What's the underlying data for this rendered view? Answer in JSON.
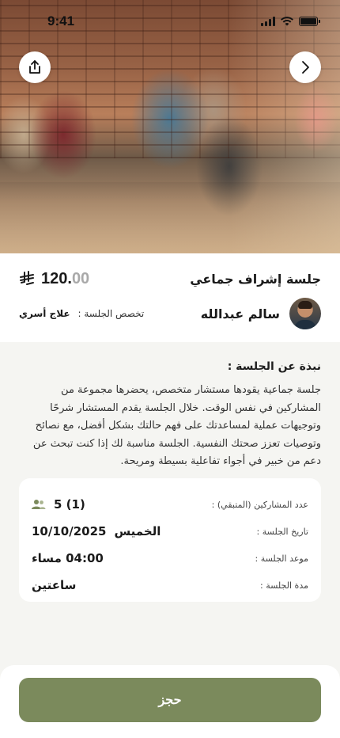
{
  "status_bar": {
    "time": "9:41"
  },
  "hero": {
    "image": "group-therapy-session-photo"
  },
  "session": {
    "title": "جلسة إشراف جماعي",
    "price_whole": "120.",
    "price_decimal": "00",
    "currency_icon": "riyal-icon",
    "counselor_name": "سالم عبدالله",
    "specialty_label": "تخصص الجلسة :",
    "specialty_value": "علاج أسري"
  },
  "about": {
    "title": "نبذة عن الجلسة :",
    "text": "جلسة جماعية يقودها مستشار متخصص، يحضرها مجموعة من المشاركين في نفس الوقت. خلال الجلسة يقدم المستشار شرحًا وتوجيهات عملية لمساعدتك على فهم حالتك بشكل أفضل، مع نصائح وتوصيات تعزز صحتك النفسية. الجلسة مناسبة لك إذا كنت تبحث عن دعم من خبير في أجواء تفاعلية بسيطة ومريحة."
  },
  "details": {
    "participants_label": "عدد المشاركين (المتبقي) :",
    "participants_value": "5 (1)",
    "date_label": "تاريخ الجلسة :",
    "date_day": "الخميس",
    "date_value": "10/10/2025",
    "time_label": "موعد الجلسة :",
    "time_value": "04:00 مساء",
    "duration_label": "مدة الجلسة :",
    "duration_value": "ساعتين"
  },
  "actions": {
    "book_label": "حجز"
  },
  "colors": {
    "accent": "#7b8a5c",
    "background": "#f5f5f2"
  }
}
